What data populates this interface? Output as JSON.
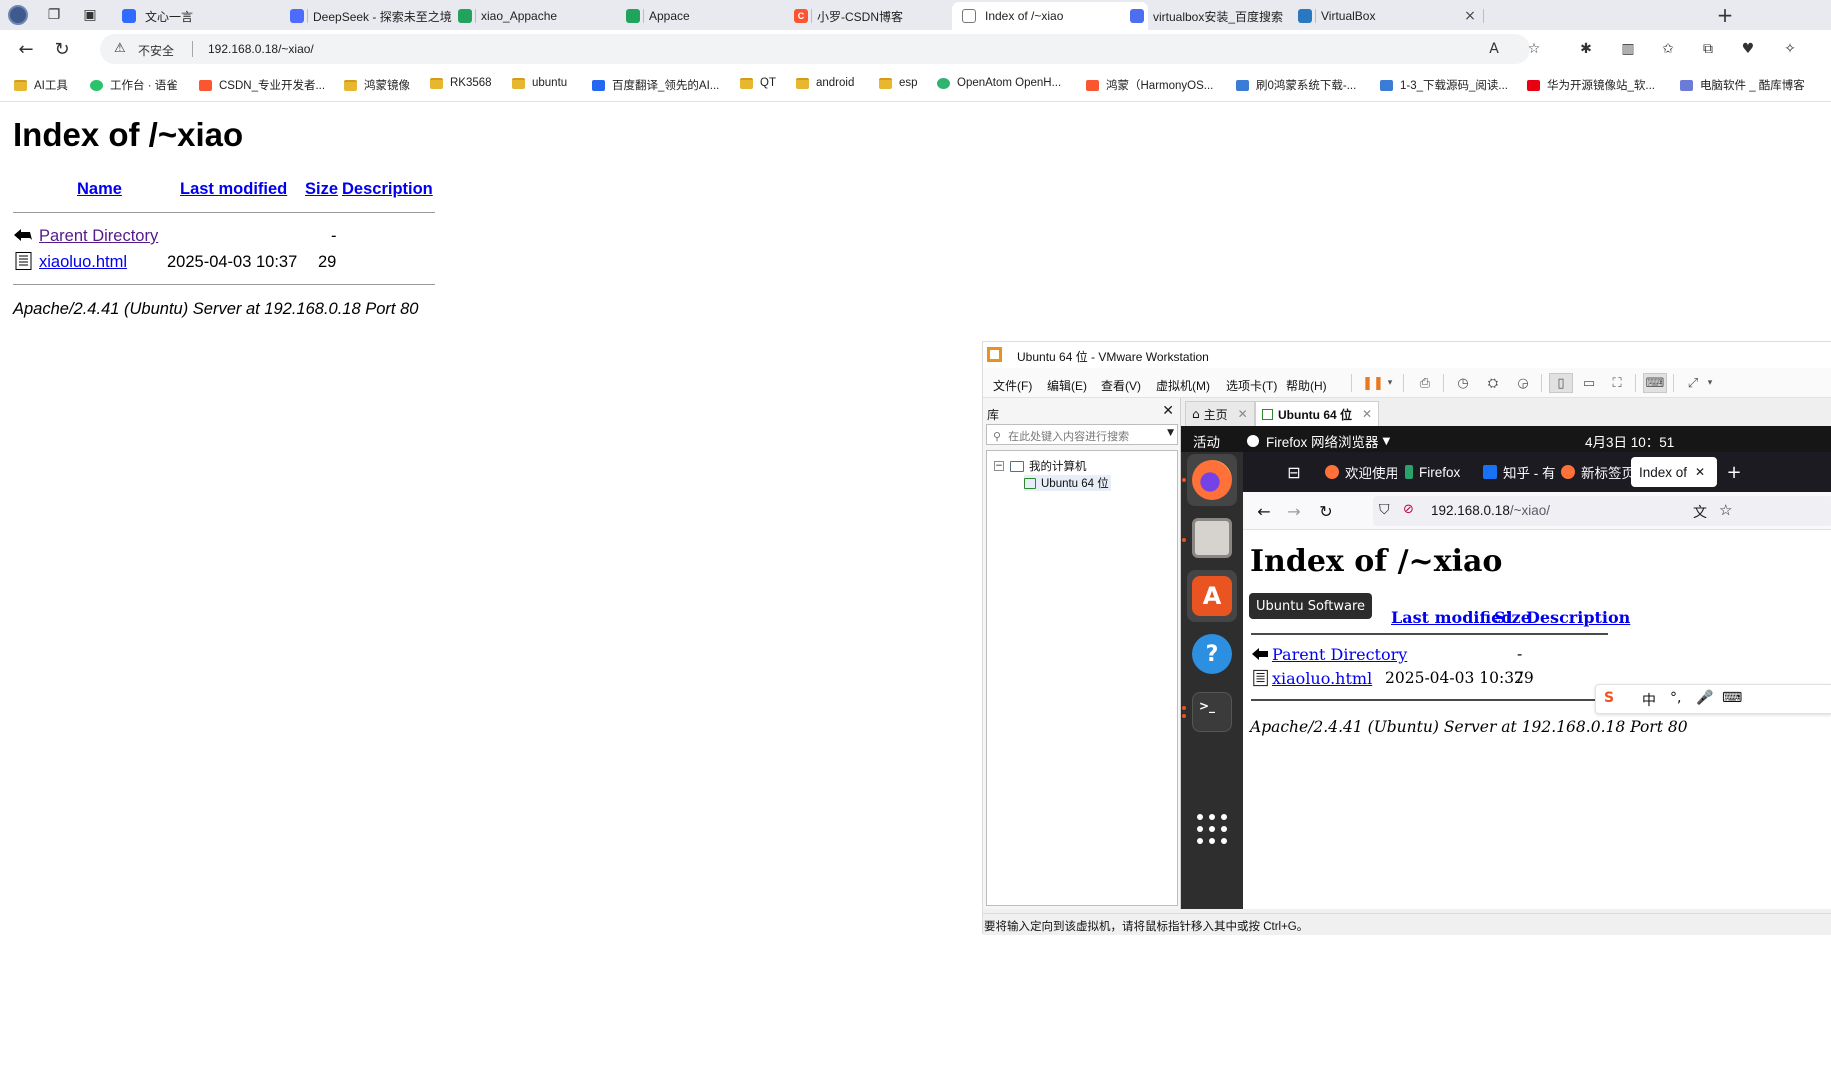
{
  "browser": {
    "tabs": [
      {
        "title": "文心一言",
        "color": "#2f6bff"
      },
      {
        "title": "DeepSeek - 探索未至之境",
        "color": "#4d6bfe"
      },
      {
        "title": "xiao_Appache",
        "color": "#1fa35d"
      },
      {
        "title": "Appace",
        "color": "#1fa35d"
      },
      {
        "title": "小罗-CSDN博客",
        "color": "#fc5531"
      },
      {
        "title": "Index of /~xiao",
        "color": "#9aa0a6"
      },
      {
        "title": "virtualbox安装_百度搜索",
        "color": "#4e6ef2"
      },
      {
        "title": "VirtualBox",
        "color": "#2b78c2"
      }
    ],
    "address": {
      "security_label": "不安全",
      "url": "192.168.0.18/~xiao/"
    },
    "bookmarks": [
      {
        "label": "AI工具",
        "type": "folder"
      },
      {
        "label": "工作台 · 语雀",
        "type": "site",
        "color": "#29c36b"
      },
      {
        "label": "CSDN_专业开发者...",
        "type": "site",
        "color": "#fc5531"
      },
      {
        "label": "鸿蒙镜像",
        "type": "folder"
      },
      {
        "label": "RK3568",
        "type": "folder"
      },
      {
        "label": "ubuntu",
        "type": "folder"
      },
      {
        "label": "百度翻译_领先的AI...",
        "type": "site",
        "color": "#2468f2"
      },
      {
        "label": "QT",
        "type": "folder"
      },
      {
        "label": "android",
        "type": "folder"
      },
      {
        "label": "esp",
        "type": "folder"
      },
      {
        "label": "OpenAtom OpenH...",
        "type": "site",
        "color": "#2fb36f"
      },
      {
        "label": "鸿蒙（HarmonyOS...",
        "type": "site",
        "color": "#fc5531"
      },
      {
        "label": "刷0鸿蒙系统下载-...",
        "type": "site",
        "color": "#3a7bd5"
      },
      {
        "label": "1-3_下载源码_阅读...",
        "type": "site",
        "color": "#3a7bd5"
      },
      {
        "label": "华为开源镜像站_软...",
        "type": "site",
        "color": "#e60012"
      },
      {
        "label": "电脑软件 _ 酷库博客",
        "type": "site",
        "color": "#6d7bd8"
      }
    ]
  },
  "page": {
    "title": "Index of /~xiao",
    "columns": [
      "Name",
      "Last modified",
      "Size",
      "Description"
    ],
    "rows": [
      {
        "name": "Parent Directory",
        "modified": "",
        "size": "-",
        "visited": true
      },
      {
        "name": "xiaoluo.html",
        "modified": "2025-04-03 10:37",
        "size": "29",
        "visited": false
      }
    ],
    "server": "Apache/2.4.41 (Ubuntu) Server at 192.168.0.18 Port 80"
  },
  "vmware": {
    "title": "Ubuntu 64 位 - VMware Workstation",
    "menus": [
      "文件(F)",
      "编辑(E)",
      "查看(V)",
      "虚拟机(M)",
      "选项卡(T)",
      "帮助(H)"
    ],
    "library": {
      "header": "库",
      "search_placeholder": "在此处键入内容进行搜索",
      "tree_root": "我的计算机",
      "tree_vm": "Ubuntu 64 位"
    },
    "tabs": [
      {
        "label": "主页"
      },
      {
        "label": "Ubuntu 64 位"
      }
    ],
    "status": "要将输入定向到该虚拟机，请将鼠标指针移入其中或按 Ctrl+G。"
  },
  "guest": {
    "activities": "活动",
    "app_menu": "Firefox 网络浏览器",
    "clock": "4月3日  10：51",
    "tooltip": "Ubuntu Software",
    "firefox": {
      "tabs": [
        "欢迎使用",
        "Firefox",
        "知乎 - 有问题",
        "新标签页",
        "Index of"
      ],
      "url_host": "192.168.0.18",
      "url_path": "/~xiao/"
    },
    "ime": {
      "mode": "中"
    }
  }
}
